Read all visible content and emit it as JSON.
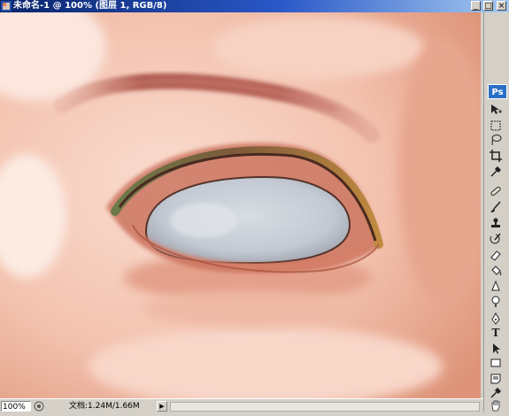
{
  "window": {
    "title": "未命名-1 @ 100% (图层 1, RGB/8)",
    "minimize_label": "_",
    "maximize_label": "□",
    "close_label": "×"
  },
  "toolbox": {
    "logo": "Ps",
    "tools": [
      {
        "name": "move-tool",
        "icon": "move-icon"
      },
      {
        "name": "marquee-tool",
        "icon": "marquee-icon"
      },
      {
        "name": "lasso-tool",
        "icon": "lasso-icon"
      },
      {
        "name": "crop-tool",
        "icon": "crop-icon"
      },
      {
        "name": "eyedropper-tool",
        "icon": "eyedropper-icon"
      },
      {
        "name": "healing-brush-tool",
        "icon": "bandage-icon"
      },
      {
        "name": "brush-tool",
        "icon": "brush-icon"
      },
      {
        "name": "clone-stamp-tool",
        "icon": "stamp-icon"
      },
      {
        "name": "history-brush-tool",
        "icon": "history-brush-icon"
      },
      {
        "name": "eraser-tool",
        "icon": "eraser-icon"
      },
      {
        "name": "paint-bucket-tool",
        "icon": "bucket-icon"
      },
      {
        "name": "blur-tool",
        "icon": "blur-icon"
      },
      {
        "name": "dodge-tool",
        "icon": "dodge-icon"
      },
      {
        "name": "pen-tool",
        "icon": "pen-icon"
      },
      {
        "name": "type-tool",
        "icon": "type-icon",
        "glyph": "T"
      },
      {
        "name": "path-selection-tool",
        "icon": "arrow-icon"
      },
      {
        "name": "shape-tool",
        "icon": "rectangle-icon"
      },
      {
        "name": "notes-tool",
        "icon": "note-icon"
      },
      {
        "name": "eyedropper-tool-2",
        "icon": "eyedropper-icon"
      },
      {
        "name": "hand-tool",
        "icon": "hand-icon"
      }
    ]
  },
  "status": {
    "zoom": "100%",
    "doc_info": "文档:1.24M/1.66M",
    "arrow": "▶"
  },
  "colors": {
    "title_start": "#0a246a",
    "title_end": "#a6caf0",
    "skin": "#f3c6b3",
    "eye_white": "#c9ced6",
    "lid_line": "#7a3b2c",
    "brow": "#b5685a"
  }
}
